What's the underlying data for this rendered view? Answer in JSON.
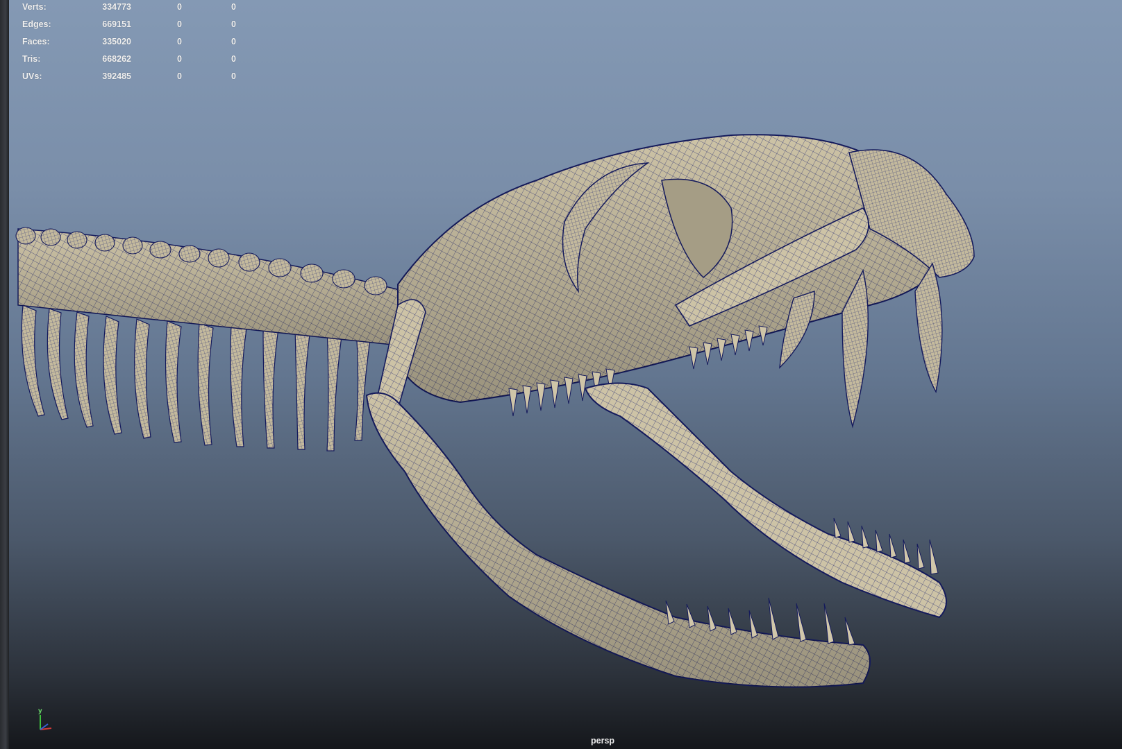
{
  "viewport": {
    "camera": "persp",
    "hud": {
      "rows": [
        {
          "label": "Verts:",
          "v1": "334773",
          "v2": "0",
          "v3": "0"
        },
        {
          "label": "Edges:",
          "v1": "669151",
          "v2": "0",
          "v3": "0"
        },
        {
          "label": "Faces:",
          "v1": "335020",
          "v2": "0",
          "v3": "0"
        },
        {
          "label": "Tris:",
          "v1": "668262",
          "v2": "0",
          "v3": "0"
        },
        {
          "label": "UVs:",
          "v1": "392485",
          "v2": "0",
          "v3": "0"
        }
      ]
    },
    "axis_gizmo": {
      "y_label": "y",
      "x_color": "#d23a3a",
      "y_color": "#3ec23e",
      "z_color": "#3a5fd6"
    },
    "model": {
      "subject": "snake skeleton (skull, jaws, fangs, vertebrae, ribs)",
      "bone_color": "#c9bfa3",
      "wire_color": "#141a5c"
    }
  }
}
